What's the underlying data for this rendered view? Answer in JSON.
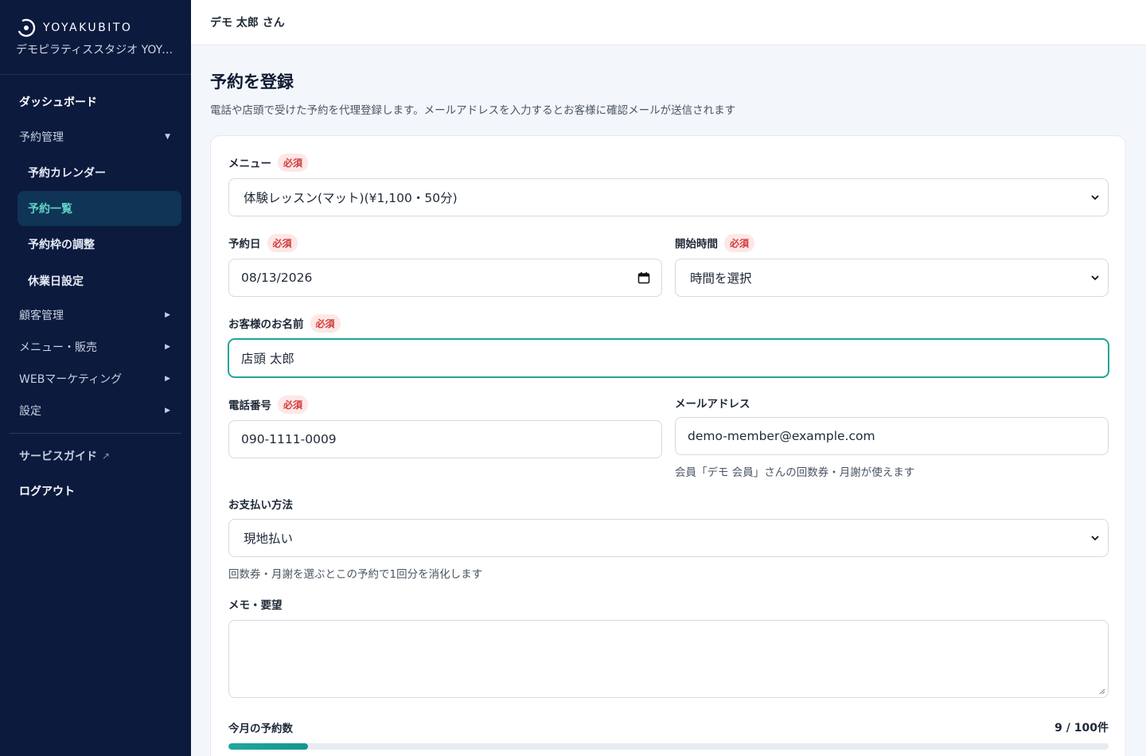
{
  "brand": {
    "name": "YOYAKUBITO",
    "studio": "デモピラティススタジオ YOYAKUBITO"
  },
  "sidebar": {
    "dashboard": "ダッシュボード",
    "reservation_group": "予約管理",
    "reservation_items": [
      "予約カレンダー",
      "予約一覧",
      "予約枠の調整",
      "休業日設定"
    ],
    "active_item": "予約一覧",
    "customer_group": "顧客管理",
    "menu_group": "メニュー・販売",
    "web_group": "WEBマーケティング",
    "settings_group": "設定",
    "service_guide": "サービスガイド",
    "logout": "ログアウト"
  },
  "topbar": {
    "user": "デモ 太郎 さん"
  },
  "page": {
    "title": "予約を登録",
    "description": "電話や店頭で受けた予約を代理登録します。メールアドレスを入力するとお客様に確認メールが送信されます"
  },
  "form": {
    "required_badge": "必須",
    "menu": {
      "label": "メニュー",
      "value": "体験レッスン(マット)(¥1,100・50分)"
    },
    "date": {
      "label": "予約日",
      "value": "08/13/2026"
    },
    "start_time": {
      "label": "開始時間",
      "value": "時間を選択"
    },
    "customer_name": {
      "label": "お客様のお名前",
      "value": "店頭 太郎"
    },
    "phone": {
      "label": "電話番号",
      "value": "090-1111-0009"
    },
    "email": {
      "label": "メールアドレス",
      "value": "demo-member@example.com",
      "hint": "会員「デモ 会員」さんの回数券・月謝が使えます"
    },
    "payment": {
      "label": "お支払い方法",
      "value": "現地払い",
      "hint": "回数券・月謝を選ぶとこの予約で1回分を消化します"
    },
    "memo": {
      "label": "メモ・要望",
      "value": ""
    }
  },
  "usage": {
    "label": "今月の予約数",
    "count_text": "9 / 100件",
    "used": 9,
    "limit": 100
  },
  "colors": {
    "sidebar_bg": "#0b1a3d",
    "accent": "#22a39a",
    "required": "#d33b3b"
  }
}
